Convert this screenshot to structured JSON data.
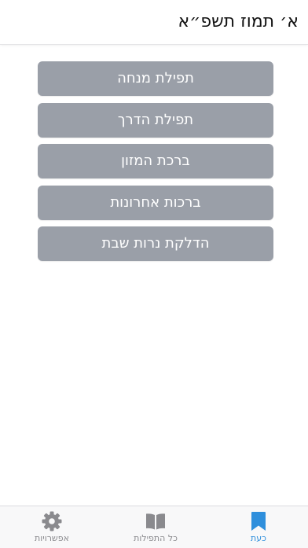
{
  "header": {
    "title": "א׳ תמוז תשפ״א"
  },
  "menu": {
    "items": [
      {
        "label": "תפילת מנחה"
      },
      {
        "label": "תפילת הדרך"
      },
      {
        "label": "ברכת המזון"
      },
      {
        "label": "ברכות אחרונות"
      },
      {
        "label": "הדלקת נרות שבת"
      }
    ]
  },
  "tabbar": {
    "tabs": [
      {
        "label": "אפשרויות",
        "icon": "gear-icon",
        "active": false
      },
      {
        "label": "כל התפילות",
        "icon": "book-icon",
        "active": false
      },
      {
        "label": "כעת",
        "icon": "bookmark-icon",
        "active": true
      }
    ]
  },
  "colors": {
    "button_bg": "#9a9fa8",
    "accent": "#2f8fdc",
    "tab_inactive": "#8a8a8e"
  }
}
